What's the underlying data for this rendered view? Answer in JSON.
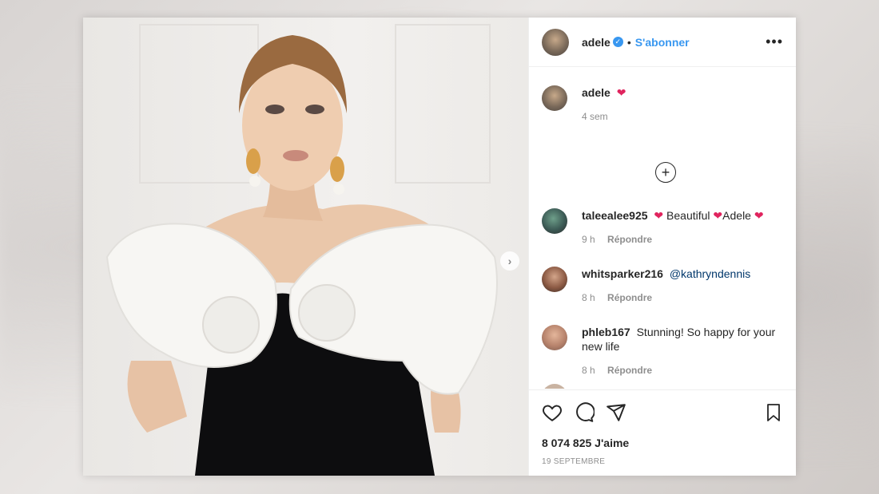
{
  "post": {
    "author": "adele",
    "follow_label": "S'abonner",
    "dot": "•",
    "more": "•••",
    "next_arrow": "›"
  },
  "caption": {
    "user": "adele",
    "text": "❤",
    "age": "4 sem"
  },
  "load_more": "+",
  "comments": [
    {
      "user": "taleealee925",
      "parts": [
        "❤",
        " Beautiful ",
        "❤",
        "Adele ",
        "❤"
      ],
      "age": "9 h",
      "reply": "Répondre"
    },
    {
      "user": "whitsparker216",
      "text": "@kathryndennis",
      "age": "8 h",
      "reply": "Répondre"
    },
    {
      "user": "phleb167",
      "text": "Stunning! So happy for your new life",
      "age": "8 h",
      "reply": "Répondre"
    }
  ],
  "likes": "8 074 825 J'aime",
  "date": "19 SEPTEMBRE",
  "colors": {
    "accent": "#3897f0",
    "heart": "#e0245e"
  },
  "icons": [
    "heart-icon",
    "comment-icon",
    "share-icon",
    "bookmark-icon",
    "verified-icon",
    "more-options-icon",
    "chevron-right-icon",
    "plus-circle-icon"
  ]
}
